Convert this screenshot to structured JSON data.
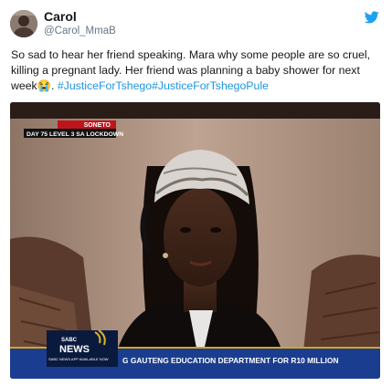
{
  "user": {
    "display_name": "Carol",
    "handle": "@Carol_MmaB",
    "avatar_icon": "user-avatar"
  },
  "platform_icon": "twitter-bird-icon",
  "tweet": {
    "text_main": "So sad to hear her friend speaking. Mara why some people are so cruel, killing a pregnant lady. Her friend was planning a baby shower for next week",
    "emoji": "😭",
    "text_after_emoji": ". ",
    "hashtag_1": "#JusticeForTshego",
    "hashtag_2": "#JusticeForTshegoPule"
  },
  "media": {
    "tv_channel_tag": "SONETO",
    "tv_lockdown_label": "DAY 75 LEVEL 3 SA LOCKDOWN",
    "news_logo_top": "SABC",
    "news_logo_main": "NEWS",
    "news_logo_sub": "SABC NEWS APP AVAILABLE NOW",
    "ticker_text": "G GAUTENG EDUCATION DEPARTMENT FOR R10 MILLION",
    "colors": {
      "ticker_bg": "#1a3d8f",
      "channel_tag_bg": "#c0141c",
      "lockdown_bg": "#111111",
      "room_wall": "#b89a86"
    }
  }
}
